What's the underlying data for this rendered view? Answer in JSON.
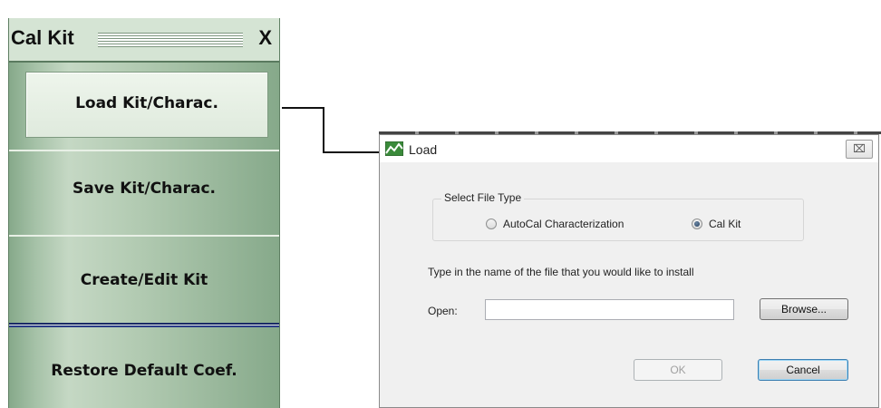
{
  "menu": {
    "title": "Cal Kit",
    "close_label": "X",
    "items": [
      {
        "label": "Load Kit/Charac."
      },
      {
        "label": "Save Kit/Charac."
      },
      {
        "label": "Create/Edit Kit"
      },
      {
        "label": "Restore Default Coef."
      }
    ]
  },
  "dialog": {
    "title": "Load",
    "close_label": "⌧",
    "group_label": "Select File Type",
    "options": [
      {
        "label": "AutoCal Characterization",
        "checked": false
      },
      {
        "label": "Cal Kit",
        "checked": true
      }
    ],
    "instruction": "Type in the name of the file that you would like to install",
    "open_label": "Open:",
    "open_value": "",
    "browse_label": "Browse...",
    "ok_label": "OK",
    "cancel_label": "Cancel"
  }
}
